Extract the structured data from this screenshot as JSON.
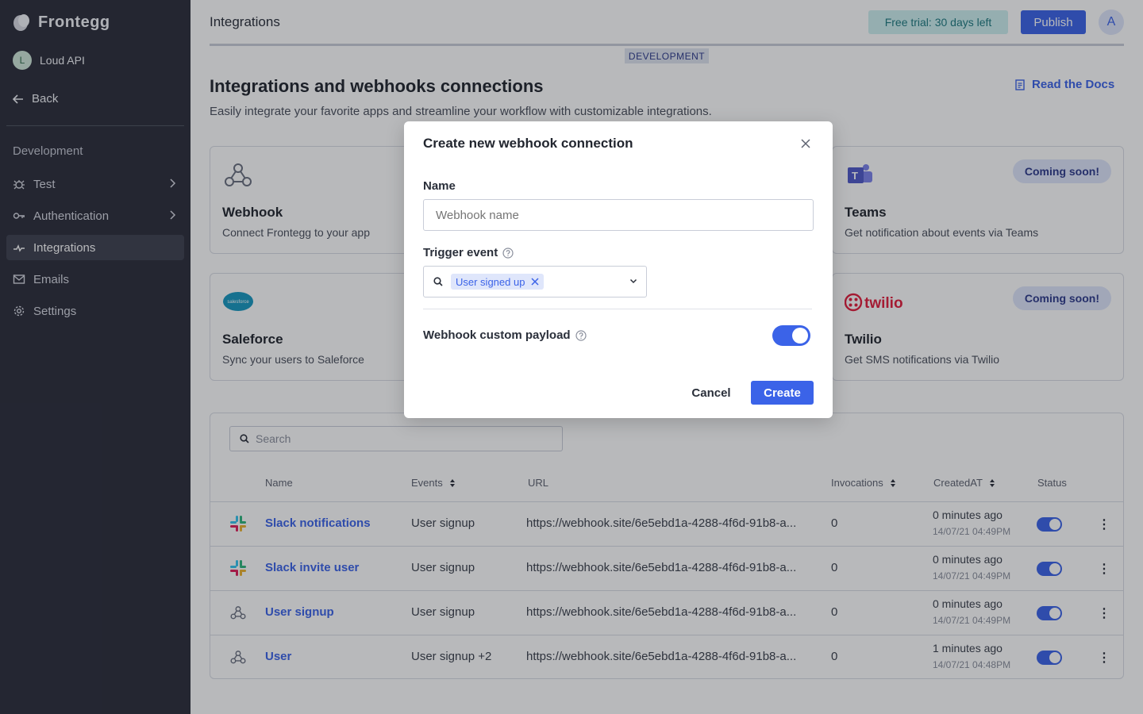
{
  "sidebar": {
    "brand": "Frontegg",
    "workspace": {
      "initial": "L",
      "name": "Loud API"
    },
    "back_label": "Back",
    "section": "Development",
    "items": [
      {
        "label": "Test",
        "icon": "bug-icon",
        "has_chevron": true
      },
      {
        "label": "Authentication",
        "icon": "key-icon",
        "has_chevron": true
      },
      {
        "label": "Integrations",
        "icon": "plug-icon",
        "active": true
      },
      {
        "label": "Emails",
        "icon": "mail-icon"
      },
      {
        "label": "Settings",
        "icon": "gear-icon"
      }
    ]
  },
  "topbar": {
    "title": "Integrations",
    "trial": "Free trial: 30 days left",
    "publish": "Publish",
    "user_initial": "A",
    "env": "DEVELOPMENT"
  },
  "page": {
    "title": "Integrations and webhooks connections",
    "subtitle": "Easily integrate your favorite apps and streamline your workflow with customizable integrations.",
    "docs_link": "Read the Docs"
  },
  "cards": [
    {
      "title": "Webhook",
      "desc": "Connect Frontegg to your app"
    },
    {
      "title": "Teams",
      "desc": "Get notification about events via Teams",
      "badge": "Coming soon!"
    },
    {
      "title": "Saleforce",
      "desc": "Sync your users to Saleforce",
      "logo_text": "salesforce"
    },
    {
      "title": "Twilio",
      "desc": "Get SMS notifications via Twilio",
      "badge": "Coming soon!",
      "logo_text": "twilio"
    }
  ],
  "table": {
    "search_placeholder": "Search",
    "columns": [
      "Name",
      "Events",
      "URL",
      "Invocations",
      "CreatedAT",
      "Status"
    ],
    "rows": [
      {
        "name": "Slack notifications",
        "events": "User signup",
        "url": "https://webhook.site/6e5ebd1a-4288-4f6d-91b8-a...",
        "invocations": "0",
        "created": "0 minutes ago",
        "ts": "14/07/21 04:49PM",
        "icon": "slack-icon"
      },
      {
        "name": "Slack invite user",
        "events": "User signup",
        "url": "https://webhook.site/6e5ebd1a-4288-4f6d-91b8-a...",
        "invocations": "0",
        "created": "0 minutes ago",
        "ts": "14/07/21 04:49PM",
        "icon": "slack-icon"
      },
      {
        "name": "User signup",
        "events": "User signup",
        "url": "https://webhook.site/6e5ebd1a-4288-4f6d-91b8-a...",
        "invocations": "0",
        "created": "0 minutes ago",
        "ts": "14/07/21 04:49PM",
        "icon": "webhook-icon"
      },
      {
        "name": "User",
        "events": "User signup +2",
        "url": "https://webhook.site/6e5ebd1a-4288-4f6d-91b8-a...",
        "invocations": "0",
        "created": "1 minutes ago",
        "ts": "14/07/21 04:48PM",
        "icon": "webhook-icon"
      }
    ]
  },
  "modal": {
    "title": "Create new webhook connection",
    "name_label": "Name",
    "name_value": "Webhook name",
    "trigger_label": "Trigger event",
    "trigger_chip": "User signed up",
    "payload_label": "Webhook custom payload",
    "payload_enabled": true,
    "cancel": "Cancel",
    "create": "Create"
  },
  "colors": {
    "sidebar": "#2b2d3a",
    "accent": "#3b63e8",
    "trial_bg": "#cdeff0"
  }
}
